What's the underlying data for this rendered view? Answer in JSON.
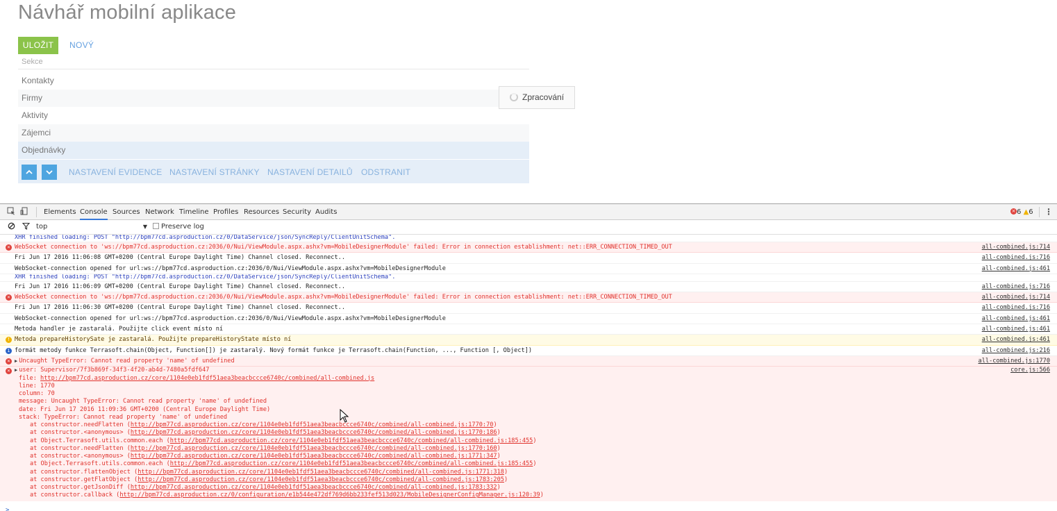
{
  "app": {
    "title": "Návhář mobilní aplikace",
    "save_label": "ULOŽIT",
    "new_label": "NOVÝ",
    "section_label": "Sekce",
    "sections": [
      "Kontakty",
      "Firmy",
      "Aktivity",
      "Zájemci",
      "Objednávky"
    ],
    "selected_section": "Objednávky",
    "actions": {
      "up_icon": "chevron-up-icon",
      "down_icon": "chevron-down-icon",
      "records": "NASTAVENÍ EVIDENCE",
      "page": "NASTAVENÍ STRÁNKY",
      "details": "NASTAVENÍ DETAILŮ",
      "delete": "ODSTRANIT"
    },
    "processing_label": "Zpracování",
    "colors": {
      "save": "#8bc34a",
      "link": "#64a0e0",
      "selected_row": "#e5eef8",
      "arrow_button": "#4ea5e0"
    }
  },
  "devtools": {
    "tabs": [
      "Elements",
      "Console",
      "Sources",
      "Network",
      "Timeline",
      "Profiles",
      "Resources",
      "Security",
      "Audits"
    ],
    "active_tab": "Console",
    "error_count": "6",
    "warning_count": "6",
    "context": "top",
    "preserve_log": "Preserve log",
    "messages": [
      {
        "level": "xhr",
        "text": "XHR finished loading: POST \"http://bpm77cd.asproduction.cz/0/DataService/json/SyncReply/ClientUnitSchema\".",
        "source": ""
      },
      {
        "level": "error",
        "text": "WebSocket connection to 'ws://bpm77cd.asproduction.cz:2036/0/Nui/ViewModule.aspx.ashx?vm=MobileDesignerModule' failed: Error in connection establishment: net::ERR_CONNECTION_TIMED_OUT",
        "source": "all-combined.js:714"
      },
      {
        "level": "log",
        "text": "Fri Jun 17 2016 11:06:08 GMT+0200 (Central Europe Daylight Time) Channel closed. Reconnect..",
        "source": "all-combined.js:716"
      },
      {
        "level": "log",
        "text": "WebSocket-connection opened for url:ws://bpm77cd.asproduction.cz:2036/0/Nui/ViewModule.aspx.ashx?vm=MobileDesignerModule",
        "source": "all-combined.js:461"
      },
      {
        "level": "xhr",
        "text": "XHR finished loading: POST \"http://bpm77cd.asproduction.cz/0/DataService/json/SyncReply/ClientUnitSchema\".",
        "source": ""
      },
      {
        "level": "log",
        "text": "Fri Jun 17 2016 11:06:09 GMT+0200 (Central Europe Daylight Time) Channel closed. Reconnect..",
        "source": "all-combined.js:716"
      },
      {
        "level": "error",
        "text": "WebSocket connection to 'ws://bpm77cd.asproduction.cz:2036/0/Nui/ViewModule.aspx.ashx?vm=MobileDesignerModule' failed: Error in connection establishment: net::ERR_CONNECTION_TIMED_OUT",
        "source": "all-combined.js:714"
      },
      {
        "level": "log",
        "text": "Fri Jun 17 2016 11:06:30 GMT+0200 (Central Europe Daylight Time) Channel closed. Reconnect..",
        "source": "all-combined.js:716"
      },
      {
        "level": "log",
        "text": "WebSocket-connection opened for url:ws://bpm77cd.asproduction.cz:2036/0/Nui/ViewModule.aspx.ashx?vm=MobileDesignerModule",
        "source": "all-combined.js:461"
      },
      {
        "level": "log",
        "text": "Metoda handler je zastaralá. Použijte click event místo ní",
        "source": "all-combined.js:461"
      },
      {
        "level": "warn",
        "text": "Metoda prepareHistorySate je zastaralá. Použijte prepareHistoryState místo ní",
        "source": "all-combined.js:461"
      },
      {
        "level": "info",
        "text": "formát metody funkce Terrasoft.chain(Object, Function[]) je zastaralý. Nový formát funkce je Terrasoft.chain(Function, ..., Function [, Object])",
        "source": "all-combined.js:216"
      },
      {
        "level": "error-expand",
        "text": "Uncaught TypeError: Cannot read property 'name' of undefined",
        "source": "all-combined.js:1770"
      }
    ],
    "detail": {
      "header": "user: Supervisor/7f3b869f-34f3-4f20-ab4d-7480a5fdf647",
      "source": "core.js:566",
      "file_key": "file: ",
      "file": "http://bpm77cd.asproduction.cz/core/1104e0eb1fdf51aea3beacbccce6740c/combined/all-combined.js",
      "line": "line: 1770",
      "column": "column: 70",
      "message": "message: Uncaught TypeError: Cannot read property 'name' of undefined",
      "date": "date: Fri Jun 17 2016 11:09:36 GMT+0200 (Central Europe Daylight Time)",
      "stack": "stack: TypeError: Cannot read property 'name' of undefined",
      "frames": [
        {
          "fn": "at constructor.needFlatten (",
          "url": "http://bpm77cd.asproduction.cz/core/1104e0eb1fdf51aea3beacbccce6740c/combined/all-combined.js:1770:70",
          "end": ")"
        },
        {
          "fn": "at constructor.<anonymous> (",
          "url": "http://bpm77cd.asproduction.cz/core/1104e0eb1fdf51aea3beacbccce6740c/combined/all-combined.js:1770:186",
          "end": ")"
        },
        {
          "fn": "at Object.Terrasoft.utils.common.each (",
          "url": "http://bpm77cd.asproduction.cz/core/1104e0eb1fdf51aea3beacbccce6740c/combined/all-combined.js:185:455",
          "end": ")"
        },
        {
          "fn": "at constructor.needFlatten (",
          "url": "http://bpm77cd.asproduction.cz/core/1104e0eb1fdf51aea3beacbccce6740c/combined/all-combined.js:1770:160",
          "end": ")"
        },
        {
          "fn": "at constructor.<anonymous> (",
          "url": "http://bpm77cd.asproduction.cz/core/1104e0eb1fdf51aea3beacbccce6740c/combined/all-combined.js:1771:347",
          "end": ")"
        },
        {
          "fn": "at Object.Terrasoft.utils.common.each (",
          "url": "http://bpm77cd.asproduction.cz/core/1104e0eb1fdf51aea3beacbccce6740c/combined/all-combined.js:185:455",
          "end": ")"
        },
        {
          "fn": "at constructor.flattenObject (",
          "url": "http://bpm77cd.asproduction.cz/core/1104e0eb1fdf51aea3beacbccce6740c/combined/all-combined.js:1771:318",
          "end": ")"
        },
        {
          "fn": "at constructor.getFlatObject (",
          "url": "http://bpm77cd.asproduction.cz/core/1104e0eb1fdf51aea3beacbccce6740c/combined/all-combined.js:1783:205",
          "end": ")"
        },
        {
          "fn": "at constructor.getJsonDiff (",
          "url": "http://bpm77cd.asproduction.cz/core/1104e0eb1fdf51aea3beacbccce6740c/combined/all-combined.js:1783:332",
          "end": ")"
        },
        {
          "fn": "at constructor.callback (",
          "url": "http://bpm77cd.asproduction.cz/0/configuration/e1b544e472df769d6bb233fef513d023/MobileDesignerConfigManager.js:120:39",
          "end": ")"
        }
      ]
    },
    "prompt": ">"
  }
}
